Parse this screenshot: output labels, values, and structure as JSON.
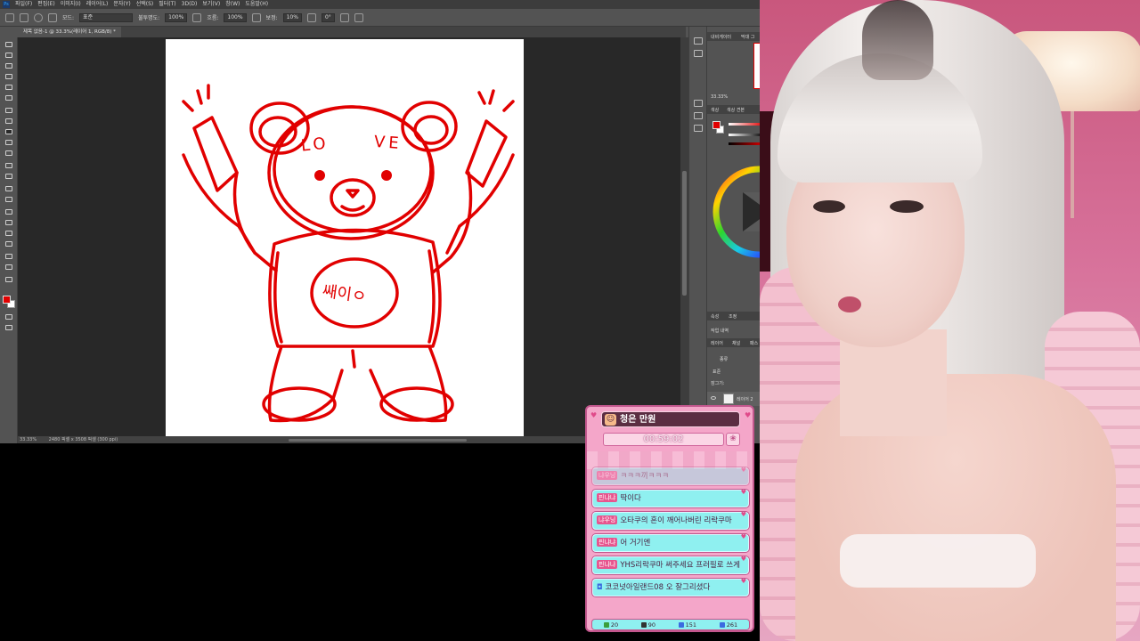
{
  "photoshop": {
    "menu": [
      "파일(F)",
      "편집(E)",
      "이미지(I)",
      "레이어(L)",
      "문자(Y)",
      "선택(S)",
      "필터(T)",
      "3D(D)",
      "보기(V)",
      "창(W)",
      "도움말(H)"
    ],
    "options": {
      "mode_label": "모드:",
      "mode_value": "표준",
      "opacity_label": "불투명도:",
      "opacity_value": "100%",
      "flow_label": "흐름:",
      "flow_value": "100%",
      "smoothing_label": "보정:",
      "smoothing_value": "10%",
      "angle_value": "0°"
    },
    "doc_tab": "제목 없음-1 @ 33.3%(레이어 1, RGB/8) *",
    "status_zoom": "33.33%",
    "status_info": "2480 픽셀 x 3508 픽셀 (300 ppi)",
    "panels": {
      "navigator_tab": "내비게이터",
      "histogram_tab": "막대 그",
      "zoom": "33.33%",
      "color_tab": "색상",
      "swatches_tab": "색상 견본",
      "props_tab": "속성",
      "adjust_tab": "조정",
      "history_tab": "작업 내역",
      "layers_tab": "레이어",
      "channels_tab": "채널",
      "paths_tab": "패스",
      "kind_label": "종류",
      "blend_value": "표준",
      "lock_label": "잠그기:",
      "layer_name": "레이어 2"
    },
    "drawing_text": [
      "LO",
      "VE"
    ],
    "shirt_text": "쌔이ㅇ"
  },
  "chat": {
    "title": "청은 만원",
    "timer": "00:59:02",
    "messages": [
      {
        "badge": "냐우닝",
        "text": "ㅋㅋㅋ끼ㅋㅋㅋ",
        "faded": true
      },
      {
        "badge": "핀냐냐",
        "text": "딱이다",
        "faded": false
      },
      {
        "badge": "냐우닝",
        "text": "오타쿠의 혼이 깨어나버린 리락쿠마",
        "faded": false
      },
      {
        "badge": "핀냐냐",
        "text": "어 거기엔",
        "faded": false
      },
      {
        "badge": "핀냐냐",
        "text": "YHS리락쿠마 써주세요 프러필로 쓰게",
        "faded": false
      },
      {
        "badge": "",
        "text": "코코넛아일랜드08 오 잘그리셨다",
        "faded": false
      }
    ],
    "stats": [
      "20",
      "90",
      "151",
      "261"
    ],
    "colors": {
      "bubble": "#8ff0f0",
      "frame": "#f4a6c9",
      "badge": "#e7558e"
    }
  },
  "colors": {
    "brush": "#e10000"
  }
}
